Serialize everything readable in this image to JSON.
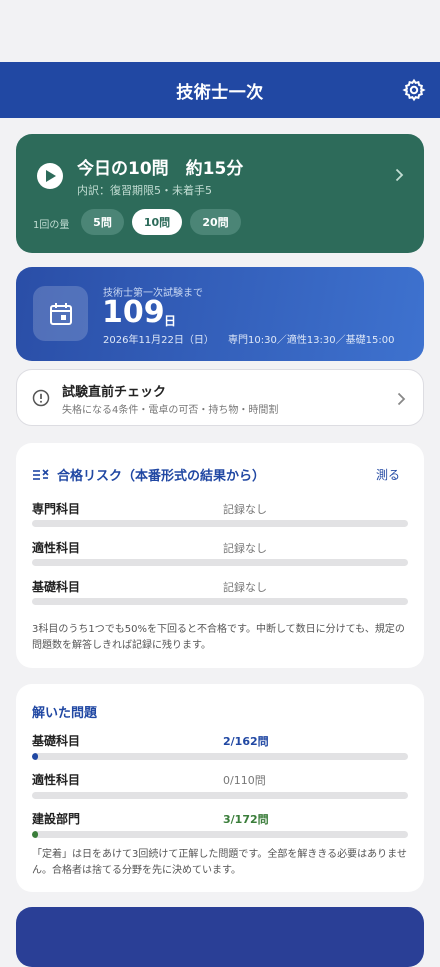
{
  "header": {
    "title": "技術士一次",
    "settings_icon": "gear-icon"
  },
  "today": {
    "title": "今日の10問　約15分",
    "subtitle": "内訳：復習期限5・未着手5",
    "amount_label": "1回の量",
    "options": [
      "5問",
      "10問",
      "20問"
    ],
    "selected": "10問"
  },
  "countdown": {
    "label": "技術士第一次試験まで",
    "days": "109",
    "unit": "日",
    "date": "2026年11月22日（日）",
    "times": "専門10:30／適性13:30／基礎15:00"
  },
  "check": {
    "title": "試験直前チェック",
    "subtitle": "失格になる4条件・電卓の可否・持ち物・時間割"
  },
  "risk": {
    "title": "合格リスク（本番形式の結果から）",
    "measure_label": "測る",
    "rows": [
      {
        "label": "専門科目",
        "value": "記録なし"
      },
      {
        "label": "適性科目",
        "value": "記録なし"
      },
      {
        "label": "基礎科目",
        "value": "記録なし"
      }
    ],
    "note": "3科目のうち1つでも50%を下回ると不合格です。中断して数日に分けても、規定の問題数を解答しきれば記録に残ります。"
  },
  "solved": {
    "title": "解いた問題",
    "rows": [
      {
        "label": "基礎科目",
        "value": "2/162問",
        "progress": 0.012,
        "color": "#2148a3"
      },
      {
        "label": "適性科目",
        "value": "0/110問",
        "progress": 0,
        "color": "#777777"
      },
      {
        "label": "建設部門",
        "value": "3/172問",
        "progress": 0.017,
        "color": "#3a7d3a"
      }
    ],
    "note": "「定着」は日をあけて3回続けて正解した問題です。全部を解ききる必要はありません。合格者は捨てる分野を先に決めています。"
  },
  "colors": {
    "brand": "#2148a3",
    "today_card": "#2d6b5a",
    "background": "#f2f2f4"
  }
}
